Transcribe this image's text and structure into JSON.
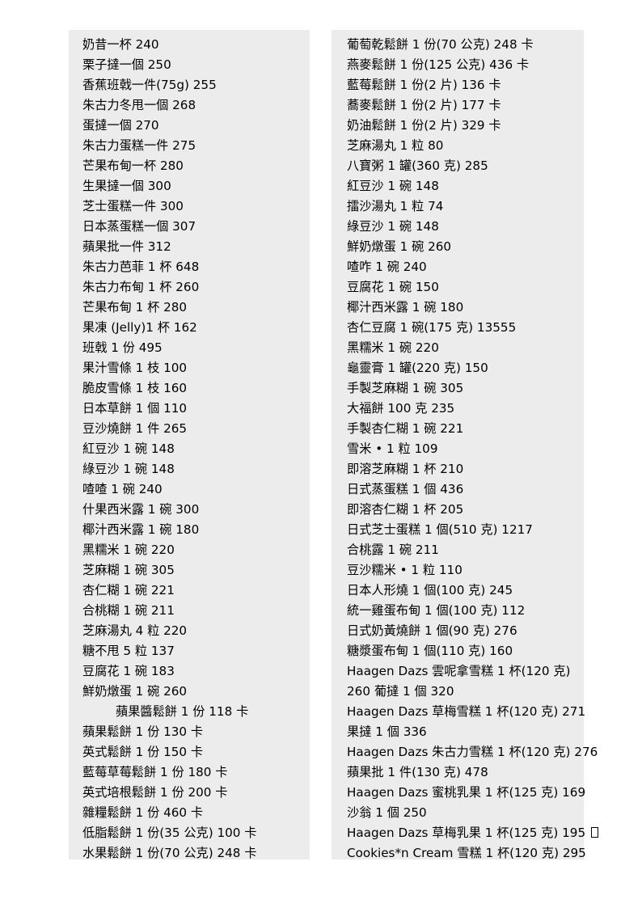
{
  "document": {
    "background_color": "#ffffff",
    "block_color": "#ececec",
    "text_color": "#000000"
  },
  "columns": {
    "left": {
      "lines": [
        {
          "text": "奶昔一杯  240"
        },
        {
          "text": "栗子撻一個  250"
        },
        {
          "text": "香蕉班戟一件(75g) 255"
        },
        {
          "text": "朱古力冬甩一個  268"
        },
        {
          "text": "蛋撻一個  270"
        },
        {
          "text": "朱古力蛋糕一件  275"
        },
        {
          "text": "芒果布甸一杯  280"
        },
        {
          "text": "生果撻一個  300"
        },
        {
          "text": "芝士蛋糕一件  300"
        },
        {
          "text": "日本蒸蛋糕一個  307"
        },
        {
          "text": "蘋果批一件  312"
        },
        {
          "text": "朱古力芭菲 1 杯 648"
        },
        {
          "text": "朱古力布甸 1 杯 260"
        },
        {
          "text": "芒果布甸  1 杯  280"
        },
        {
          "text": "果凍  (Jelly)1 杯 162"
        },
        {
          "text": "班戟 1 份 495"
        },
        {
          "text": "果汁雪條  1 枝  100"
        },
        {
          "text": "脆皮雪條  1 枝  160"
        },
        {
          "text": "日本草餅  1 個  110"
        },
        {
          "text": "豆沙燒餅  1 件  265"
        },
        {
          "text": "紅豆沙  1 碗  148"
        },
        {
          "text": "綠豆沙  1 碗  148"
        },
        {
          "text": "喳喳  1 碗  240"
        },
        {
          "text": "什果西米露  1 碗  300"
        },
        {
          "text": "椰汁西米露  1 碗  180"
        },
        {
          "text": "黑糯米  1 碗  220"
        },
        {
          "text": "芝麻糊  1 碗  305"
        },
        {
          "text": "杏仁糊  1 碗  221"
        },
        {
          "text": "合桃糊  1 碗  211"
        },
        {
          "text": "芝麻湯丸  4 粒  220"
        },
        {
          "text": "糖不甩  5 粒  137"
        },
        {
          "text": "豆腐花  1 碗  183"
        },
        {
          "text": "鮮奶燉蛋  1 碗  260"
        },
        {
          "text": "蘋果醬鬆餅  1 份  118 卡",
          "style": "indent"
        },
        {
          "text": "蘋果鬆餅  1 份  130 卡"
        },
        {
          "text": "英式鬆餅  1 份  150 卡"
        },
        {
          "text": "藍莓草莓鬆餅  1 份  180 卡"
        },
        {
          "text": "英式培根鬆餅  1 份  200 卡"
        },
        {
          "text": "雜糧鬆餅  1 份  460 卡"
        },
        {
          "text": "低脂鬆餅  1 份(35 公克) 100 卡"
        },
        {
          "text": "水果鬆餅  1 份(70 公克) 248 卡"
        }
      ]
    },
    "right": {
      "lines": [
        {
          "text": "葡萄乾鬆餅  1 份(70 公克) 248 卡"
        },
        {
          "text": "燕麥鬆餅  1 份(125 公克) 436 卡"
        },
        {
          "text": "藍莓鬆餅  1 份(2 片) 136 卡"
        },
        {
          "text": "蕎麥鬆餅  1 份(2 片) 177 卡"
        },
        {
          "text": "奶油鬆餅  1 份(2 片) 329 卡"
        },
        {
          "text": "芝麻湯丸  1 粒  80"
        },
        {
          "text": "八寶粥  1 罐(360 克) 285"
        },
        {
          "text": "紅豆沙  1 碗  148"
        },
        {
          "text": "擂沙湯丸  1 粒  74"
        },
        {
          "text": "綠豆沙  1 碗  148"
        },
        {
          "text": "鮮奶燉蛋  1 碗  260"
        },
        {
          "text": "喳咋  1 碗  240"
        },
        {
          "text": "豆腐花  1 碗  150"
        },
        {
          "text": "椰汁西米露  1 碗  180"
        },
        {
          "text": "杏仁豆腐  1 碗(175 克) 13555"
        },
        {
          "text": "黑糯米  1 碗  220"
        },
        {
          "text": "龜靈膏  1 罐(220 克) 150"
        },
        {
          "text": "手製芝麻糊  1 碗  305"
        },
        {
          "text": "大福餅  100 克  235"
        },
        {
          "text": "手製杏仁糊  1 碗  221"
        },
        {
          "text": "雪米 •  1 粒  109"
        },
        {
          "text": "即溶芝麻糊  1 杯  210"
        },
        {
          "text": "日式蒸蛋糕  1 個  436"
        },
        {
          "text": "即溶杏仁糊  1 杯  205"
        },
        {
          "text": "日式芝士蛋糕  1 個(510 克) 1217"
        },
        {
          "text": "合桃露  1 碗  211"
        },
        {
          "text": "豆沙糯米 •  1 粒  110"
        },
        {
          "text": "日本人形燒  1 個(100 克) 245"
        },
        {
          "text": "統一雞蛋布甸  1 個(100 克) 112"
        },
        {
          "text": "日式奶黃燒餅  1 個(90 克) 276"
        },
        {
          "text": "糖漿蛋布甸  1 個(110 克) 160"
        },
        {
          "text": "Haagen Dazs 雲呢拿雪糕  1 杯(120 克)"
        },
        {
          "text": "260  葡撻  1 個  320",
          "style": "cont"
        },
        {
          "text": "Haagen Dazs 草梅雪糕  1 杯(120 克) 271"
        },
        {
          "text": "果撻  1 個  336"
        },
        {
          "text": "Haagen Dazs 朱古力雪糕  1 杯(120 克) 276"
        },
        {
          "text": "蘋果批  1 件(130 克) 478"
        },
        {
          "text": "Haagen Dazs 蜜桃乳果  1 杯(125 克) 169"
        },
        {
          "text": "沙翁  1 個  250"
        },
        {
          "text": "Haagen Dazs 草梅乳果  1 杯(125 克) 195 ",
          "tofu": true
        },
        {
          "text": "Cookies*n Cream 雪糕  1 杯(120 克) 295"
        }
      ]
    }
  }
}
